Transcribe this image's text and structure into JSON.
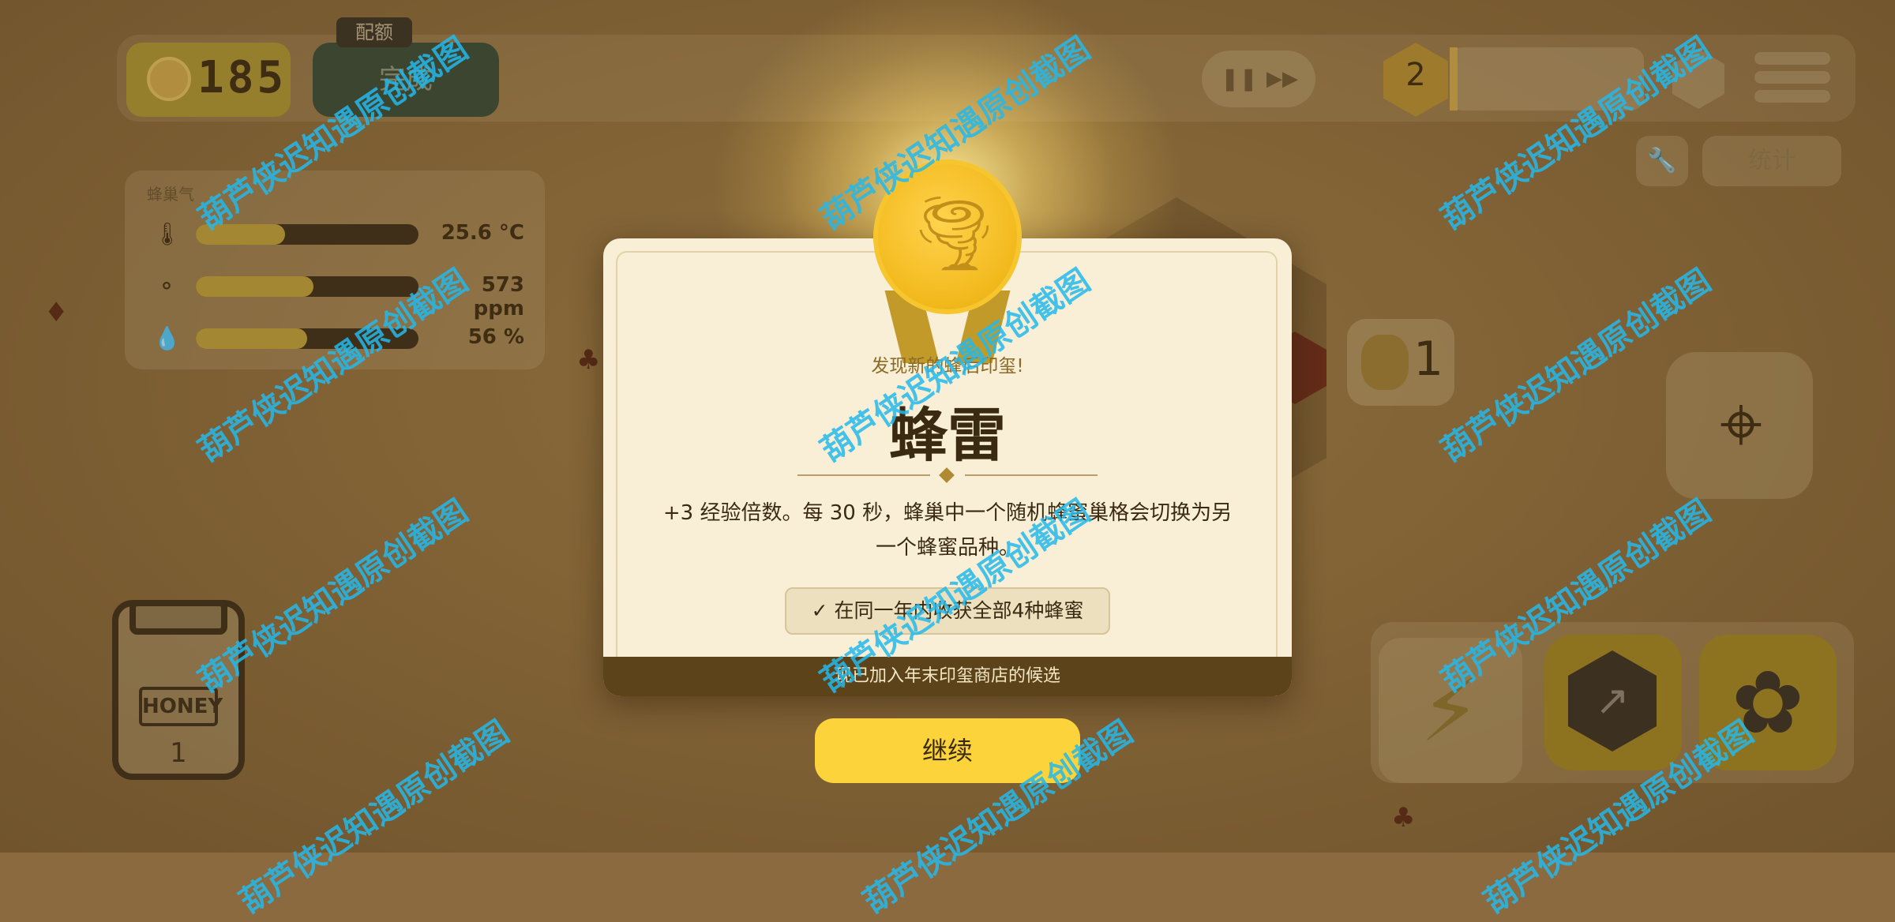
{
  "hud": {
    "coins": "185",
    "quota_tag": "配额",
    "done_label": "完成",
    "level": "2",
    "stats_label": "统计",
    "icons": {
      "coin": "bee-coin-icon",
      "pause": "pause-icon",
      "fast_forward": "fast-forward-icon",
      "gem": "hex-gem-icon",
      "menu": "menu-icon",
      "wrench": "wrench-icon"
    }
  },
  "hive_panel": {
    "title": "蜂巢气",
    "meters": [
      {
        "icon": "thermometer-icon",
        "value": "25.6 °C",
        "fill": 0.4
      },
      {
        "icon": "co2-icon",
        "value": "573 ppm",
        "fill": 0.53
      },
      {
        "icon": "humidity-drop-icon",
        "value": "56 %",
        "fill": 0.5
      }
    ]
  },
  "jar": {
    "label": "HONEY",
    "count": "1"
  },
  "queen": {
    "count": "1"
  },
  "modal": {
    "subtitle": "发现新的蜂后印玺!",
    "title": "蜂雷",
    "description": "+3 经验倍数。每 30 秒，蜂巢中一个随机蜂蜜巢格会切换为另一个蜂蜜品种。",
    "condition": "✓ 在同一年内收获全部4种蜂蜜",
    "footer": "现已加入年末印玺商店的候选",
    "continue_label": "继续",
    "medal_icon": "tornado-icon"
  },
  "watermark": "葫芦侠迟知遇原创截图",
  "colors": {
    "accent_yellow": "#fcd33a",
    "modal_bg": "#f8efd6",
    "footer_bg": "#5c4319",
    "watermark": "#23b9eb"
  }
}
